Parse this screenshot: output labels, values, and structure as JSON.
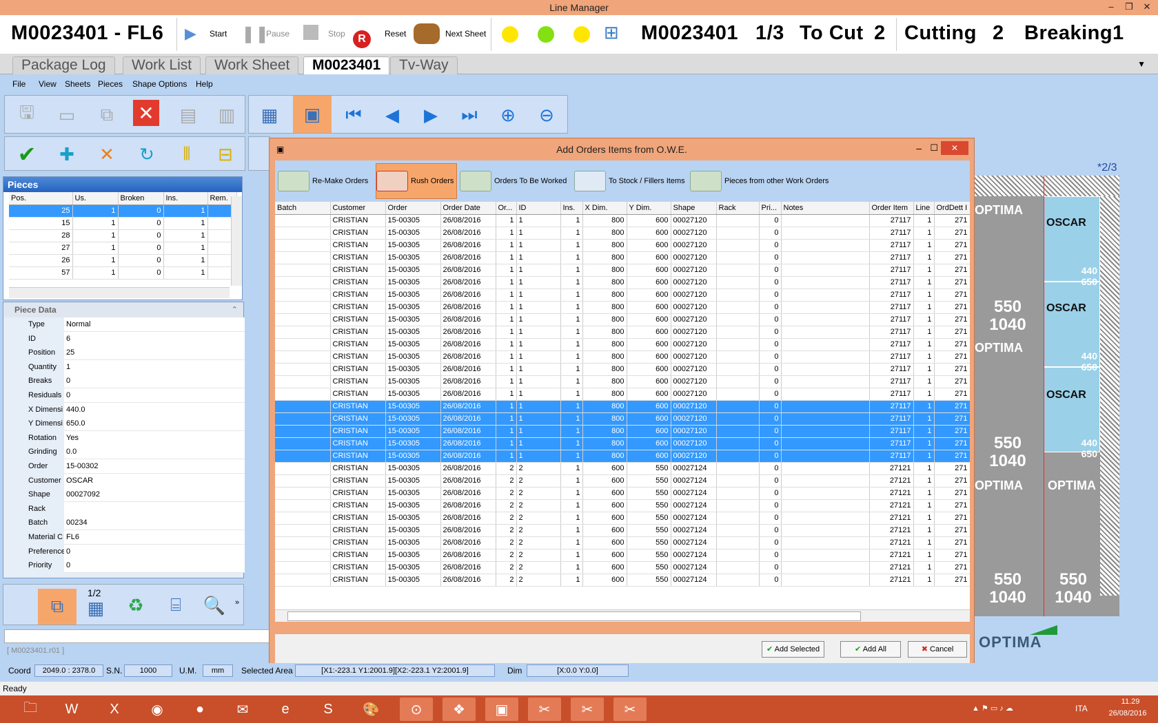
{
  "window": {
    "title": "Line Manager"
  },
  "header": {
    "machine": "M0023401 - FL6",
    "buttons": [
      "Start",
      "Pause",
      "Stop",
      "Reset",
      "Next Sheet"
    ],
    "status_job": "M0023401",
    "status_sheet": "1/3",
    "status_tocut_label": "To Cut",
    "status_tocut": "2",
    "status_cutting_label": "Cutting",
    "status_cutting": "2",
    "status_breaking_label": "Breaking",
    "status_breaking": "1"
  },
  "tabs": [
    "Package Log",
    "Work List",
    "Work Sheet",
    "M0023401",
    "Tv-Way"
  ],
  "menu": [
    "File",
    "View",
    "Sheets",
    "Pieces",
    "Shape Options",
    "Help"
  ],
  "pieces": {
    "title": "Pieces",
    "columns": [
      "Pos.",
      "Us.",
      "Broken",
      "Ins.",
      "Rem."
    ],
    "rows": [
      [
        "25",
        "1",
        "0",
        "1"
      ],
      [
        "15",
        "1",
        "0",
        "1"
      ],
      [
        "28",
        "1",
        "0",
        "1"
      ],
      [
        "27",
        "1",
        "0",
        "1"
      ],
      [
        "26",
        "1",
        "0",
        "1"
      ],
      [
        "57",
        "1",
        "0",
        "1"
      ]
    ]
  },
  "piece_data": {
    "title": "Piece Data",
    "fields": [
      {
        "k": "Type",
        "v": "Normal"
      },
      {
        "k": "ID",
        "v": "6"
      },
      {
        "k": "Position",
        "v": "25"
      },
      {
        "k": "Quantity",
        "v": "1"
      },
      {
        "k": "Breaks",
        "v": "0"
      },
      {
        "k": "Residuals",
        "v": "0"
      },
      {
        "k": "X Dimensi",
        "v": "440.0"
      },
      {
        "k": "Y Dimensi",
        "v": "650.0"
      },
      {
        "k": "Rotation",
        "v": "Yes"
      },
      {
        "k": "Grinding",
        "v": "0.0"
      },
      {
        "k": "Order",
        "v": "15-00302"
      },
      {
        "k": "Customer",
        "v": "OSCAR"
      },
      {
        "k": "Shape",
        "v": "00027092"
      },
      {
        "k": "Rack",
        "v": ""
      },
      {
        "k": "Batch",
        "v": "00234"
      },
      {
        "k": "Material C",
        "v": "FL6"
      },
      {
        "k": "Preference",
        "v": "0"
      },
      {
        "k": "Priority",
        "v": "0"
      }
    ]
  },
  "bottom_tool_label": "1/2",
  "path_field": "[ M0023401.r01 ]",
  "dialog": {
    "title": "Add Orders Items from O.W.E.",
    "toolbar": [
      "Re-Make Orders",
      "Rush Orders",
      "Orders To Be Worked",
      "To Stock / Fillers Items",
      "Pieces from other Work Orders"
    ],
    "columns": [
      "Batch",
      "Customer",
      "Order",
      "Order Date",
      "Or...",
      "ID",
      "Ins.",
      "X Dim.",
      "Y Dim.",
      "Shape",
      "Rack",
      "Pri...",
      "Notes",
      "Order Item",
      "Line",
      "OrdDett I"
    ],
    "group_a": {
      "customer": "CRISTIAN",
      "order": "15-00305",
      "date": "26/08/2016",
      "or": "1",
      "id": "1",
      "ins": "1",
      "x": "800",
      "y": "600",
      "shape": "00027120",
      "pri": "0",
      "item": "27117",
      "line": "1",
      "orddett": "271",
      "count": 20,
      "selected_from": 15
    },
    "group_b": {
      "customer": "CRISTIAN",
      "order": "15-00305",
      "date": "26/08/2016",
      "or": "2",
      "id": "2",
      "ins": "1",
      "x": "600",
      "y": "550",
      "shape": "00027124",
      "pri": "0",
      "item": "27121",
      "line": "1",
      "orddett": "271",
      "count": 10
    },
    "buttons": [
      "Add Selected",
      "Add All",
      "Cancel"
    ]
  },
  "preview": {
    "sheet_label": "*2/3",
    "pieces": [
      {
        "name": "OPTIMA",
        "dims": "550\n1040"
      },
      {
        "name": "OSCAR",
        "dims": "440\n650"
      },
      {
        "name": "OSCAR",
        "dims": "440\n650"
      },
      {
        "name": "OPTIMA",
        "dims": "550\n1040"
      },
      {
        "name": "OSCAR",
        "dims": "440\n650"
      },
      {
        "name": "OPTIMA",
        "dims": "550\n1040"
      },
      {
        "name": "OPTIMA",
        "dims": "550\n1040"
      }
    ],
    "logo": "OPTIMA"
  },
  "status": {
    "coord_label": "Coord",
    "coord": "2049.0 : 2378.0",
    "sn_label": "S.N.",
    "sn": "1000",
    "um_label": "U.M.",
    "um": "mm",
    "area_label": "Selected Area",
    "area": "[X1:-223.1 Y1:2001.9][X2:-223.1 Y2:2001.9]",
    "dim_label": "Dim",
    "dim": "[X:0.0 Y:0.0]",
    "ready": "Ready"
  },
  "tray": {
    "lang": "ITA",
    "time": "11.29",
    "date": "26/08/2016"
  }
}
